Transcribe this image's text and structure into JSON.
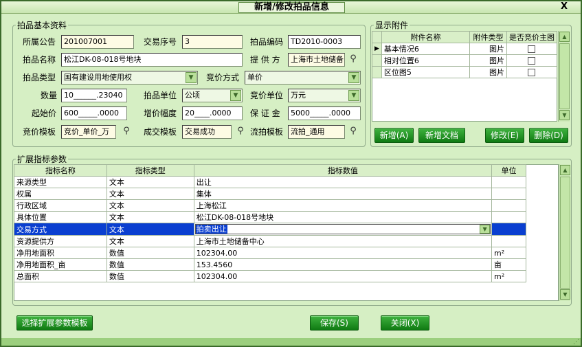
{
  "window": {
    "title": "新增/修改拍品信息",
    "close_label": "X"
  },
  "basic": {
    "legend": "拍品基本资料",
    "announcement_label": "所属公告",
    "announcement_value": "201007001",
    "trade_no_label": "交易序号",
    "trade_no_value": "3",
    "code_label": "拍品编码",
    "code_value": "TD2010-0003",
    "name_label": "拍品名称",
    "name_value": "松江DK-08-018号地块",
    "provider_label": "提 供 方",
    "provider_value": "上海市土地储备中",
    "type_label": "拍品类型",
    "type_value": "国有建设用地使用权",
    "bid_method_label": "竞价方式",
    "bid_method_value": "单价",
    "qty_label": "数量",
    "qty_value": "10______.23040",
    "unit_label": "拍品单位",
    "unit_value": "公顷",
    "bid_unit_label": "竞价单位",
    "bid_unit_value": "万元",
    "start_price_label": "起始价",
    "start_price_value": "600_____.0000",
    "increment_label": "增价幅度",
    "increment_value": "20____.0000",
    "deposit_label": "保 证 金",
    "deposit_value": "5000_____.0000",
    "bid_template_label": "竞价模板",
    "bid_template_value": "竞价_单价_万",
    "deal_template_label": "成交模板",
    "deal_template_value": "交易成功",
    "fail_template_label": "流拍模板",
    "fail_template_value": "流拍_通用"
  },
  "attachments": {
    "legend": "显示附件",
    "headers": [
      "附件名称",
      "附件类型",
      "是否竞价主图"
    ],
    "rows": [
      {
        "name": "基本情况6",
        "type": "图片"
      },
      {
        "name": "相对位置6",
        "type": "图片"
      },
      {
        "name": "区位图5",
        "type": "图片"
      }
    ],
    "add_label": "新增(A)",
    "add_doc_label": "新增文档",
    "edit_label": "修改(E)",
    "delete_label": "删除(D)"
  },
  "ext": {
    "legend": "扩展指标参数",
    "headers": [
      "指标名称",
      "指标类型",
      "指标数值",
      "单位"
    ],
    "rows": [
      {
        "name": "来源类型",
        "type": "文本",
        "value": "出让",
        "unit": ""
      },
      {
        "name": "权属",
        "type": "文本",
        "value": "集体",
        "unit": ""
      },
      {
        "name": "行政区域",
        "type": "文本",
        "value": "上海松江",
        "unit": ""
      },
      {
        "name": "具体位置",
        "type": "文本",
        "value": "松江DK-08-018号地块",
        "unit": ""
      },
      {
        "name": "交易方式",
        "type": "文本",
        "value": "拍卖出让",
        "unit": ""
      },
      {
        "name": "资源提供方",
        "type": "文本",
        "value": "上海市土地储备中心",
        "unit": ""
      },
      {
        "name": "净用地面积",
        "type": "数值",
        "value": "102304.00",
        "unit": "m²"
      },
      {
        "name": "净用地面积_亩",
        "type": "数值",
        "value": "153.4560",
        "unit": "亩"
      },
      {
        "name": "总面积",
        "type": "数值",
        "value": "102304.00",
        "unit": "m²"
      }
    ],
    "selected_row": 4
  },
  "footer": {
    "template_label": "选择扩展参数模板",
    "save_label": "保存(S)",
    "close_label": "关闭(X)"
  },
  "colors": {
    "accent": "#0a3fd0",
    "button_green": "#1a8f1d",
    "panel_bg": "#d6efc4"
  }
}
